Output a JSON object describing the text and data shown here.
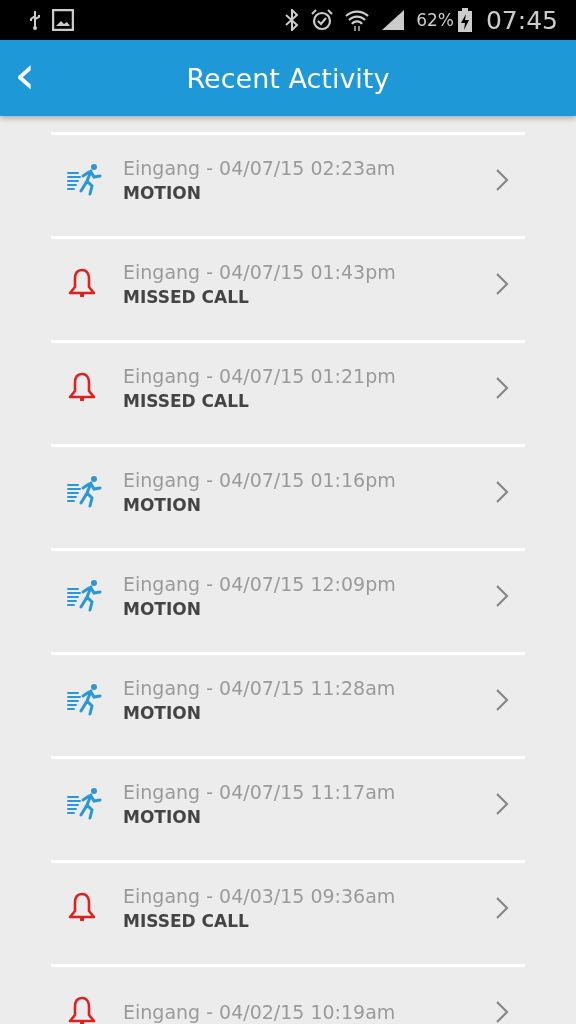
{
  "status_bar": {
    "battery": "62%",
    "time": "07:45"
  },
  "header": {
    "back": "‹",
    "title": "Recent Activity"
  },
  "activities": [
    {
      "kind": "motion",
      "title": "Eingang - 04/07/15 02:23am",
      "label": "MOTION"
    },
    {
      "kind": "missed_call",
      "title": "Eingang - 04/07/15 01:43pm",
      "label": "MISSED CALL"
    },
    {
      "kind": "missed_call",
      "title": "Eingang - 04/07/15 01:21pm",
      "label": "MISSED CALL"
    },
    {
      "kind": "motion",
      "title": "Eingang - 04/07/15 01:16pm",
      "label": "MOTION"
    },
    {
      "kind": "motion",
      "title": "Eingang - 04/07/15 12:09pm",
      "label": "MOTION"
    },
    {
      "kind": "motion",
      "title": "Eingang - 04/07/15 11:28am",
      "label": "MOTION"
    },
    {
      "kind": "motion",
      "title": "Eingang - 04/07/15 11:17am",
      "label": "MOTION"
    },
    {
      "kind": "missed_call",
      "title": "Eingang - 04/03/15 09:36am",
      "label": "MISSED CALL"
    },
    {
      "kind": "missed_call",
      "title": "Eingang - 04/02/15 10:19am"
    }
  ]
}
